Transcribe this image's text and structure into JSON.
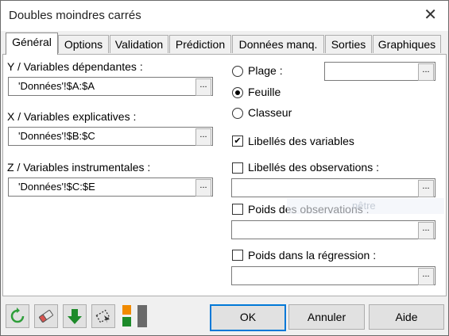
{
  "window": {
    "title": "Doubles moindres carrés",
    "close_glyph": "✕"
  },
  "tabs": [
    {
      "label": "Général",
      "active": true
    },
    {
      "label": "Options"
    },
    {
      "label": "Validation"
    },
    {
      "label": "Prédiction"
    },
    {
      "label": "Données manq."
    },
    {
      "label": "Sorties"
    },
    {
      "label": "Graphiques"
    }
  ],
  "left": {
    "y_label": "Y / Variables dépendantes :",
    "y_value": "'Données'!$A:$A",
    "x_label": "X / Variables explicatives :",
    "x_value": "'Données'!$B:$C",
    "z_label": "Z / Variables instrumentales :",
    "z_value": "'Données'!$C:$E"
  },
  "right": {
    "range_options": [
      {
        "label": "Plage :",
        "selected": false
      },
      {
        "label": "Feuille",
        "selected": true
      },
      {
        "label": "Classeur",
        "selected": false
      }
    ],
    "range_field_value": "",
    "var_labels_checkbox": {
      "label": "Libellés des variables",
      "checked": true
    },
    "obs_labels_checkbox": {
      "label": "Libellés des observations :",
      "checked": false
    },
    "obs_labels_value": "",
    "obs_weights_checkbox": {
      "label": "Poids des observations :",
      "checked": false
    },
    "obs_weights_value": "",
    "reg_weights_checkbox": {
      "label": "Poids dans la régression :",
      "checked": false
    },
    "reg_weights_value": "",
    "ghost_text": "nêtre"
  },
  "ref_button_glyph": "...",
  "toolbar": {
    "ok_label": "OK",
    "cancel_label": "Annuler",
    "help_label": "Aide",
    "icons": [
      "reset-icon",
      "eraser-icon",
      "download-arrow-icon",
      "select-icon",
      "layout-squares-icon"
    ]
  },
  "colors": {
    "accent": "#0078d7",
    "reset_green": "#2e9e3a",
    "arrow_green": "#1d8a2a",
    "orange": "#f08a00"
  }
}
